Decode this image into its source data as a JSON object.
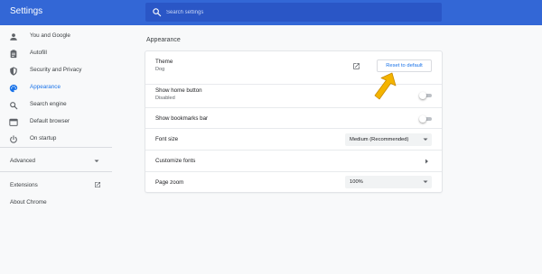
{
  "header": {
    "title": "Settings",
    "search_placeholder": "Search settings",
    "search_value": ""
  },
  "sidebar": {
    "items": [
      {
        "label": "You and Google",
        "icon": "person-icon"
      },
      {
        "label": "Autofill",
        "icon": "clipboard-icon"
      },
      {
        "label": "Security and Privacy",
        "icon": "shield-icon"
      },
      {
        "label": "Appearance",
        "icon": "palette-icon",
        "active": true
      },
      {
        "label": "Search engine",
        "icon": "search-icon"
      },
      {
        "label": "Default browser",
        "icon": "browser-icon"
      },
      {
        "label": "On startup",
        "icon": "power-icon"
      }
    ],
    "advanced_label": "Advanced",
    "extensions_label": "Extensions",
    "about_label": "About Chrome"
  },
  "main": {
    "section_title": "Appearance",
    "theme": {
      "label": "Theme",
      "value": "Dog",
      "reset_label": "Reset to default"
    },
    "home_button": {
      "label": "Show home button",
      "sub": "Disabled",
      "enabled": false
    },
    "bookmarks_bar": {
      "label": "Show bookmarks bar",
      "enabled": false
    },
    "font_size": {
      "label": "Font size",
      "selected": "Medium (Recommended)"
    },
    "customize_fonts": {
      "label": "Customize fonts"
    },
    "page_zoom": {
      "label": "Page zoom",
      "selected": "100%"
    }
  },
  "colors": {
    "header": "#3367d6",
    "accent": "#1a73e8",
    "annotation_arrow": "#f4b400"
  }
}
